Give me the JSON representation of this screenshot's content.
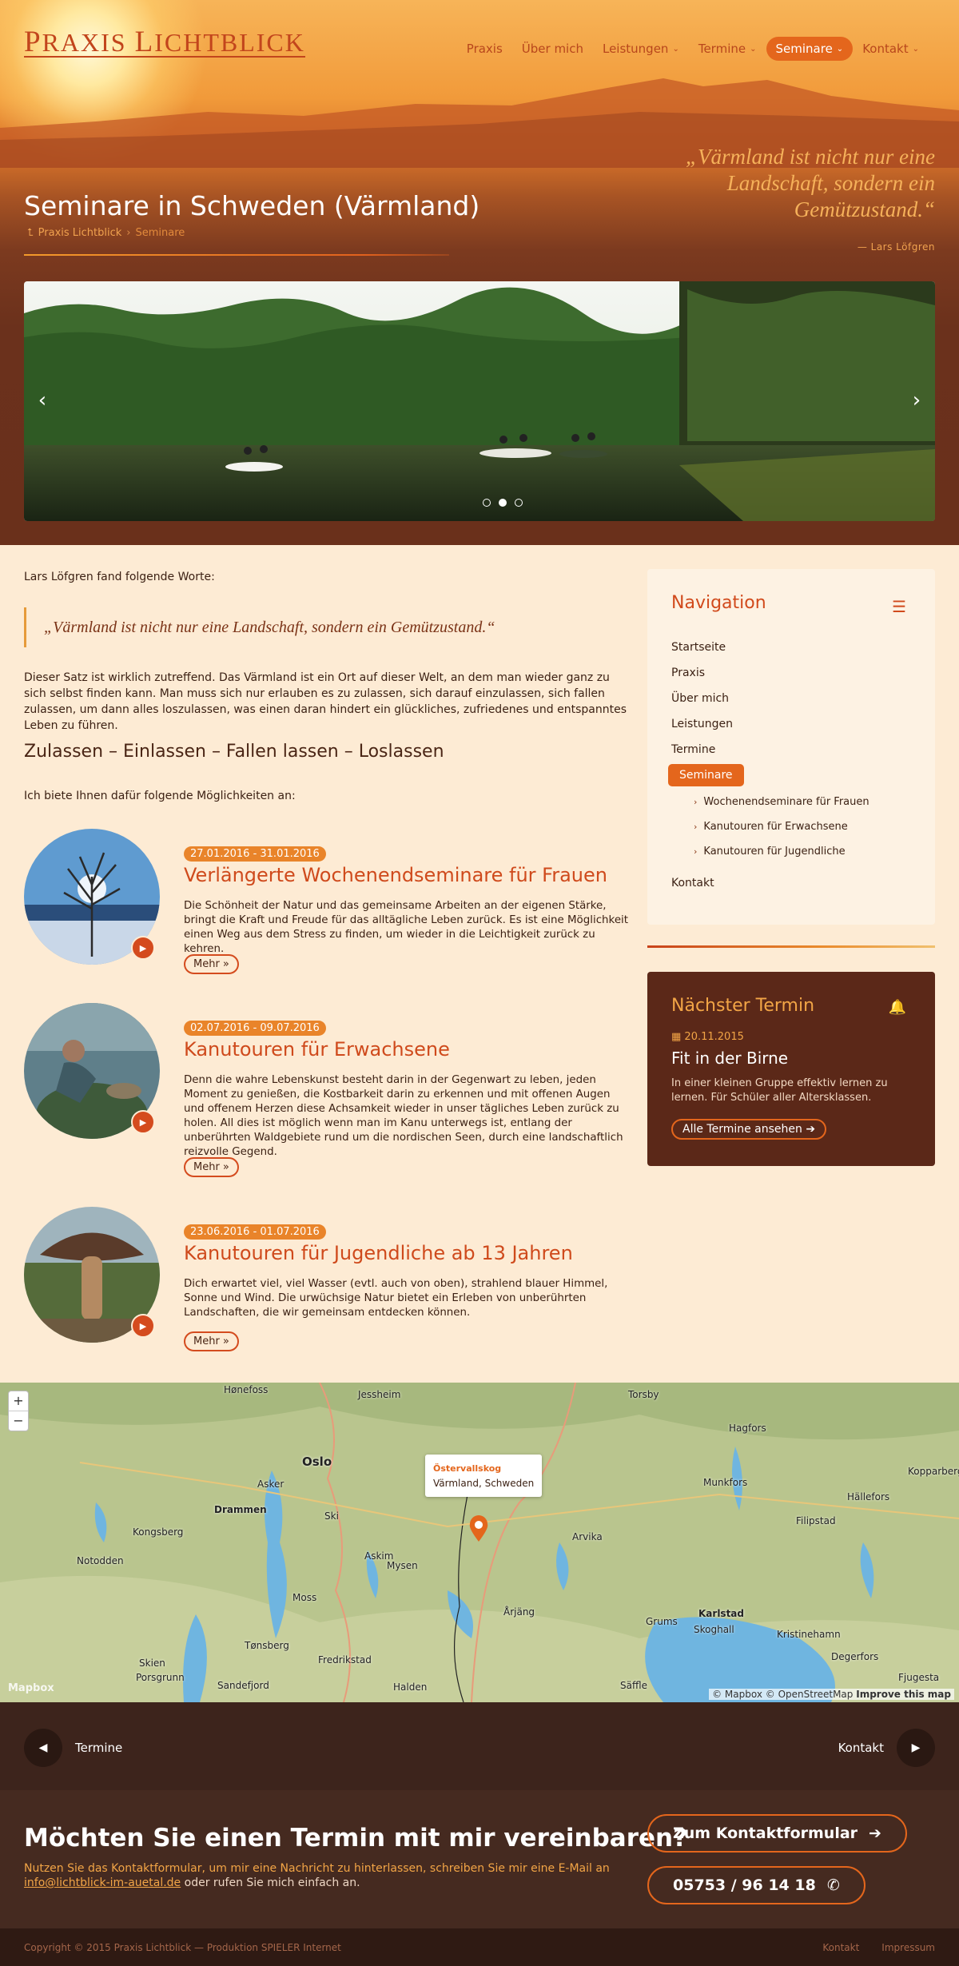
{
  "brand": {
    "name_first": "P",
    "name_rest1": "RAXIS ",
    "name_second": "L",
    "name_rest2": "ICHTBLICK"
  },
  "nav": {
    "items": [
      {
        "label": "Praxis",
        "dropdown": false
      },
      {
        "label": "Über mich",
        "dropdown": false
      },
      {
        "label": "Leistungen",
        "dropdown": true
      },
      {
        "label": "Termine",
        "dropdown": true
      },
      {
        "label": "Seminare",
        "dropdown": true,
        "active": true
      },
      {
        "label": "Kontakt",
        "dropdown": true
      }
    ]
  },
  "hero": {
    "title": "Seminare in Schweden (Värmland)",
    "breadcrumb": {
      "home": "Praxis Lichtblick",
      "separator": "›",
      "current": "Seminare"
    },
    "quote": "„Värmland ist nicht nur eine Landschaft, sondern ein Gemützustand.“",
    "cite": "— Lars Löfgren"
  },
  "slider": {
    "prev": "‹",
    "next": "›",
    "dots": 3,
    "active_dot": 1
  },
  "content": {
    "intro": "Lars Löfgren fand folgende Worte:",
    "blockquote": "„Värmland ist nicht nur eine Landschaft, sondern ein Gemützustand.“",
    "paragraph": "Dieser Satz ist wirklich zutreffend. Das Värmland ist ein Ort auf dieser Welt, an dem man wieder ganz zu sich selbst finden kann. Man muss sich nur erlauben es zu zulassen, sich darauf einzulassen, sich fallen zulassen, um dann alles loszulassen, was einen daran hindert ein glückliches, zufriedenes und entspanntes Leben zu führen.",
    "heading": "Zulassen – Einlassen – Fallen lassen – Loslassen",
    "lead": "Ich biete Ihnen dafür folgende Möglichkeiten an:",
    "seminars": [
      {
        "date": "27.01.2016 - 31.01.2016",
        "title": "Verlängerte Wochenendseminare für Frauen",
        "desc": "Die Schönheit der Natur und das gemeinsame Arbeiten an der eigenen Stärke, bringt die Kraft und Freude für das alltägliche Leben zurück. Es ist eine Möglichkeit einen Weg aus dem Stress zu finden, um wieder in die Leichtigkeit zurück zu kehren.",
        "more": "Mehr »"
      },
      {
        "date": "02.07.2016 - 09.07.2016",
        "title": "Kanutouren für Erwachsene",
        "desc": "Denn die wahre Lebenskunst besteht darin in der Gegenwart zu leben, jeden Moment zu genießen, die Kostbarkeit darin zu erkennen und mit offenen Augen und offenem Herzen diese Achsamkeit wieder in unser tägliches Leben zurück zu holen. All dies ist möglich wenn man im Kanu unterwegs ist, entlang der unberührten Waldgebiete rund um die nordischen Seen, durch eine landschaftlich reizvolle Gegend.",
        "more": "Mehr »"
      },
      {
        "date": "23.06.2016 - 01.07.2016",
        "title": "Kanutouren für Jugendliche ab 13 Jahren",
        "desc": "Dich erwartet viel, viel Wasser (evtl. auch von oben), strahlend blauer Himmel, Sonne und Wind. Die urwüchsige Natur bietet ein Erleben von unberührten Landschaften, die wir gemeinsam entdecken können.",
        "more": "Mehr »"
      }
    ]
  },
  "sidebar": {
    "nav_title": "Navigation",
    "links": [
      "Startseite",
      "Praxis",
      "Über mich",
      "Leistungen",
      "Termine"
    ],
    "active": "Seminare",
    "sublinks": [
      "Wochenendseminare für Frauen",
      "Kanutouren für Erwachsene",
      "Kanutouren für Jugendliche"
    ],
    "last": "Kontakt",
    "termin": {
      "title": "Nächster Termin",
      "date": "20.11.2015",
      "event": "Fit in der Birne",
      "desc": "In einer kleinen Gruppe effektiv lernen zu lernen. Für Schüler aller Altersklassen.",
      "button": "Alle Termine ansehen"
    }
  },
  "map": {
    "zoom_in": "+",
    "zoom_out": "−",
    "popup_title": "Östervallskog",
    "popup_sub": "Värmland, Schweden",
    "attribution": "© Mapbox © OpenStreetMap",
    "improve": "Improve this map",
    "logo": "Mapbox",
    "towns": [
      "Hønefoss",
      "Jessheim",
      "Torsby",
      "Hagfors",
      "Oslo",
      "Asker",
      "Drammen",
      "Kongsberg",
      "Notodden",
      "Ski",
      "Askim",
      "Mysen",
      "Moss",
      "Arvika",
      "Munkfors",
      "Kopparberg",
      "Hällefors",
      "Filipstad",
      "Årjäng",
      "Grums",
      "Karlstad",
      "Skoghall",
      "Kristinehamn",
      "Degerfors",
      "Fjugesta",
      "Tønsberg",
      "Fredrikstad",
      "Skien",
      "Porsgrunn",
      "Sandefjord",
      "Halden",
      "Säffle"
    ]
  },
  "pager": {
    "prev": "Termine",
    "next": "Kontakt"
  },
  "cta": {
    "heading": "Möchten Sie einen Termin mit mir vereinbaren?",
    "text": "Nutzen Sie das Kontaktformular, um mir eine Nachricht zu hinterlassen, schreiben Sie mir eine E-Mail an",
    "email": "info@lichtblick-im-auetal.de",
    "text_end": "oder rufen Sie mich einfach an.",
    "btn_form": "Zum Kontaktformular",
    "btn_phone": "05753 / 96 14 18"
  },
  "footer": {
    "copyright": "Copyright © 2015 Praxis Lichtblick — Produktion SPIELER Internet",
    "links": [
      "Kontakt",
      "Impressum"
    ]
  },
  "colors": {
    "accent": "#e4661c",
    "brand": "#c2451c",
    "dark": "#5b2818",
    "bg": "#fdebd4"
  }
}
